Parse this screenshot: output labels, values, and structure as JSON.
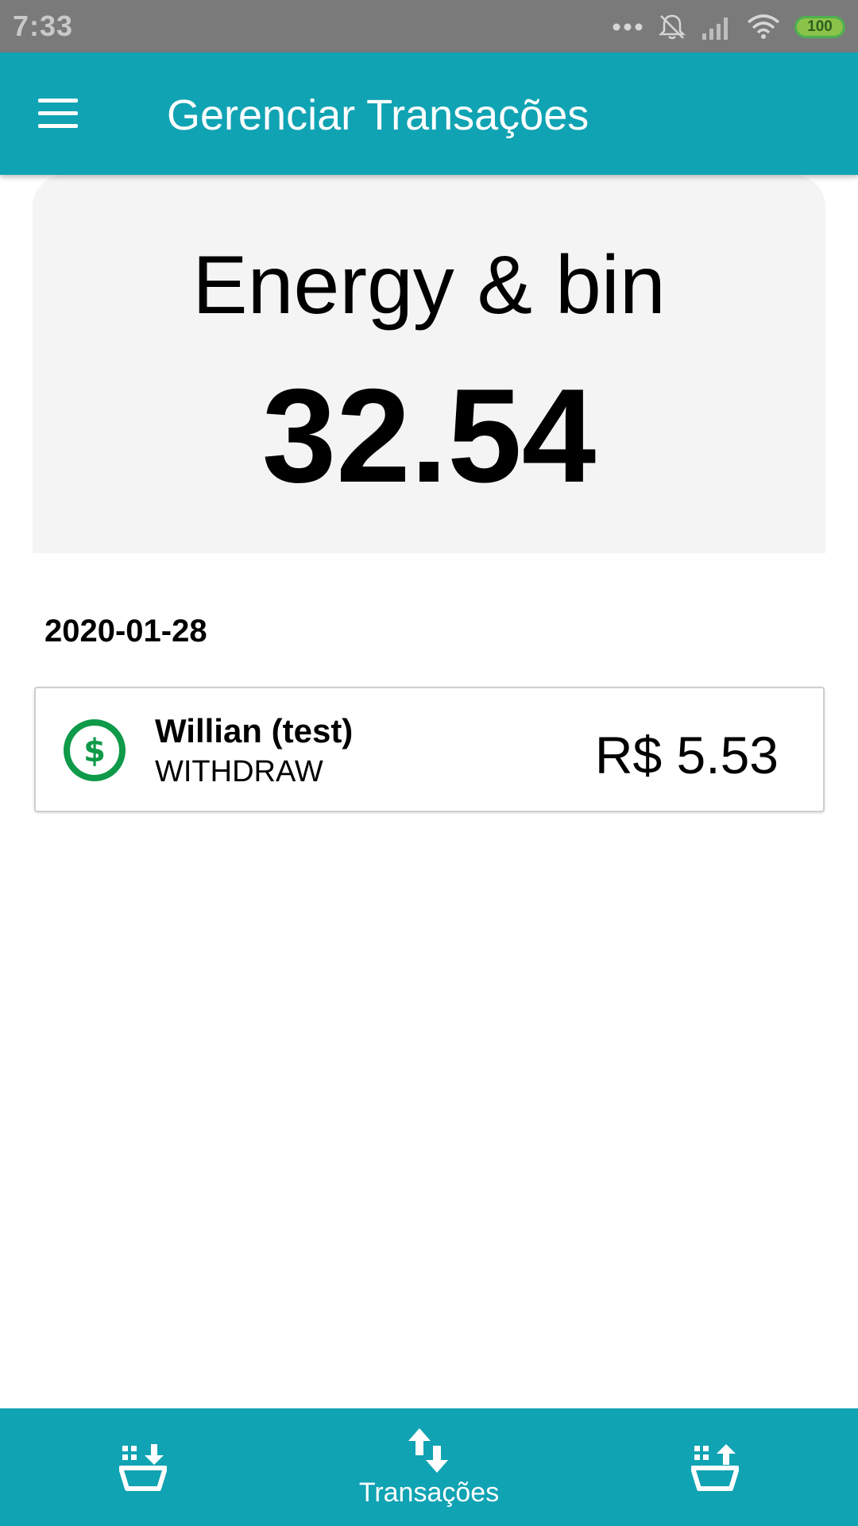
{
  "status_bar": {
    "time": "7:33",
    "battery": "100",
    "icons": [
      "more-dots-icon",
      "notifications-off-icon",
      "signal-icon",
      "wifi-icon",
      "battery-icon"
    ]
  },
  "app_bar": {
    "title": "Gerenciar Transações",
    "menu_icon": "hamburger-menu-icon"
  },
  "balance_card": {
    "account_name": "Energy & bin",
    "balance": "32.54"
  },
  "transactions": {
    "groups": [
      {
        "date": "2020-01-28",
        "items": [
          {
            "icon": "dollar-circle-icon",
            "person": "Willian (test)",
            "type": "WITHDRAW",
            "amount": "R$ 5.53"
          }
        ]
      }
    ]
  },
  "bottom_nav": {
    "items": [
      {
        "icon": "basket-download-icon",
        "label": ""
      },
      {
        "icon": "swap-vertical-icon",
        "label": "Transações",
        "active": true
      },
      {
        "icon": "basket-upload-icon",
        "label": ""
      }
    ]
  },
  "colors": {
    "primary": "#10a3b3",
    "status_bar": "#7a7a7a",
    "card_background": "#f4f4f4",
    "income_icon": "#0e9a48"
  }
}
